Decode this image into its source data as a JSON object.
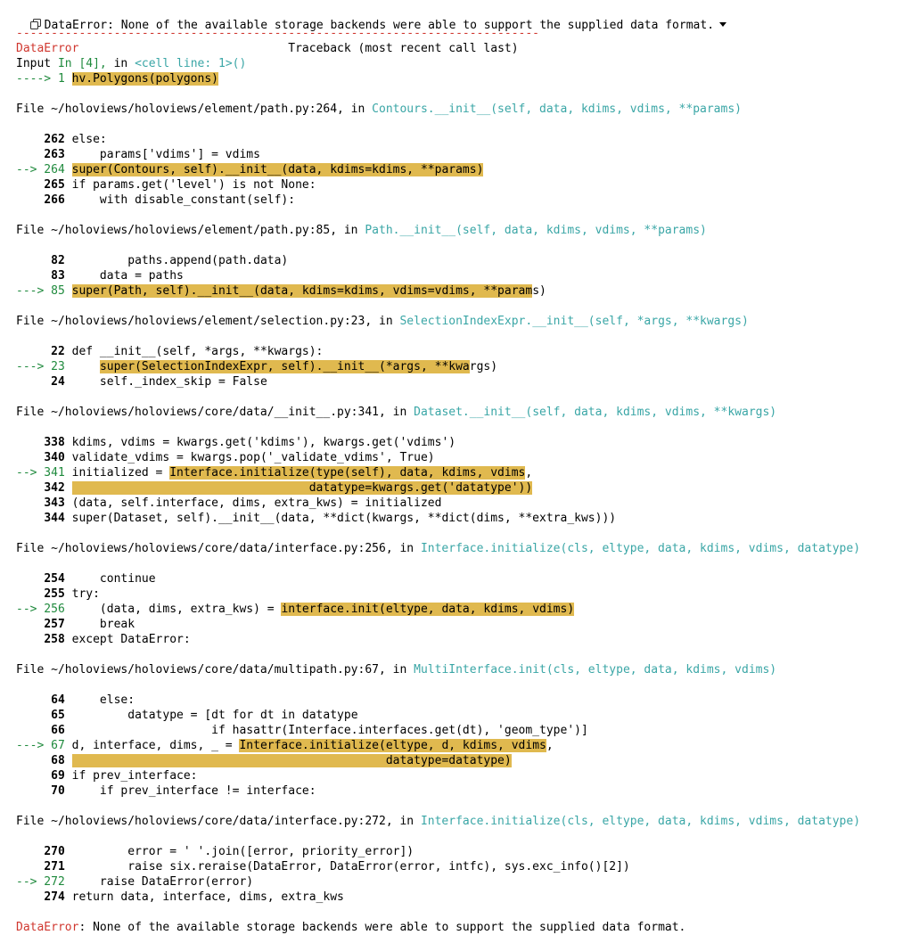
{
  "header": {
    "summary": "DataError: None of the available storage backends were able to support the supplied data format."
  },
  "traceback": {
    "separator": "---------------------------------------------------------------------------",
    "error_name": "DataError",
    "traceback_label": "Traceback (most recent call last)",
    "input_prefix": "Input",
    "input_ref": "In [4],",
    "input_in": " in ",
    "input_cell": "<cell line: 1>()",
    "input_arrow": "----> 1",
    "input_code": "hv.Polygons(polygons)",
    "frames": [
      {
        "file": "File ~/holoviews/holoviews/element/path.py:264,",
        "func": "Contours.__init__(self, data, kdims, vdims, **params)",
        "lines": [
          {
            "num": "262",
            "code": "else:"
          },
          {
            "num": "263",
            "code": "    params['vdims'] = vdims"
          },
          {
            "num": "--> 264",
            "code": "super(Contours, self).__init__(data, kdims=kdims, **params)"
          },
          {
            "num": "265",
            "code": "if params.get('level') is not None:"
          },
          {
            "num": "266",
            "code": "    with disable_constant(self):"
          }
        ]
      },
      {
        "file": "File ~/holoviews/holoviews/element/path.py:85,",
        "func": "Path.__init__(self, data, kdims, vdims, **params)",
        "lines": [
          {
            "num": "82",
            "code": "        paths.append(path.data)"
          },
          {
            "num": "83",
            "code": "    data = paths"
          },
          {
            "num": "---> 85",
            "code": "super(Path, self).__init__(data, kdims=kdims, vdims=vdims, **params)"
          }
        ]
      },
      {
        "file": "File ~/holoviews/holoviews/element/selection.py:23,",
        "func": "SelectionIndexExpr.__init__(self, *args, **kwargs)",
        "lines": [
          {
            "num": "22",
            "code": "def __init__(self, *args, **kwargs):"
          },
          {
            "num": "---> 23",
            "code": "    super(SelectionIndexExpr, self).__init__(*args, **kwargs)"
          },
          {
            "num": "24",
            "code": "    self._index_skip = False"
          }
        ]
      },
      {
        "file": "File ~/holoviews/holoviews/core/data/__init__.py:341,",
        "func": "Dataset.__init__(self, data, kdims, vdims, **kwargs)",
        "lines": [
          {
            "num": "338",
            "code": "kdims, vdims = kwargs.get('kdims'), kwargs.get('vdims')"
          },
          {
            "num": "340",
            "code": "validate_vdims = kwargs.pop('_validate_vdims', True)"
          },
          {
            "num": "--> 341",
            "code": "initialized = Interface.initialize(type(self), data, kdims, vdims,"
          },
          {
            "num": "342",
            "code": "                                  datatype=kwargs.get('datatype'))"
          },
          {
            "num": "343",
            "code": "(data, self.interface, dims, extra_kws) = initialized"
          },
          {
            "num": "344",
            "code": "super(Dataset, self).__init__(data, **dict(kwargs, **dict(dims, **extra_kws)))"
          }
        ]
      },
      {
        "file": "File ~/holoviews/holoviews/core/data/interface.py:256,",
        "func": "Interface.initialize(cls, eltype, data, kdims, vdims, datatype)",
        "lines": [
          {
            "num": "254",
            "code": "    continue"
          },
          {
            "num": "255",
            "code": "try:"
          },
          {
            "num": "--> 256",
            "code": "    (data, dims, extra_kws) = interface.init(eltype, data, kdims, vdims)"
          },
          {
            "num": "257",
            "code": "    break"
          },
          {
            "num": "258",
            "code": "except DataError:"
          }
        ]
      },
      {
        "file": "File ~/holoviews/holoviews/core/data/multipath.py:67,",
        "func": "MultiInterface.init(cls, eltype, data, kdims, vdims)",
        "lines": [
          {
            "num": "64",
            "code": "    else:"
          },
          {
            "num": "65",
            "code": "        datatype = [dt for dt in datatype"
          },
          {
            "num": "66",
            "code": "                    if hasattr(Interface.interfaces.get(dt), 'geom_type')]"
          },
          {
            "num": "---> 67",
            "code": "d, interface, dims, _ = Interface.initialize(eltype, d, kdims, vdims,"
          },
          {
            "num": "68",
            "code": "                                             datatype=datatype)"
          },
          {
            "num": "69",
            "code": "if prev_interface:"
          },
          {
            "num": "70",
            "code": "    if prev_interface != interface:"
          }
        ]
      },
      {
        "file": "File ~/holoviews/holoviews/core/data/interface.py:272,",
        "func": "Interface.initialize(cls, eltype, data, kdims, vdims, datatype)",
        "lines": [
          {
            "num": "270",
            "code": "        error = ' '.join([error, priority_error])"
          },
          {
            "num": "271",
            "code": "        raise six.reraise(DataError, DataError(error, intfc), sys.exc_info()[2])"
          },
          {
            "num": "--> 272",
            "code": "    raise DataError(error)"
          },
          {
            "num": "274",
            "code": "return data, interface, dims, extra_kws"
          }
        ]
      }
    ],
    "final_error_name": "DataError",
    "final_error_message": ": None of the available storage backends were able to support the supplied data format."
  }
}
